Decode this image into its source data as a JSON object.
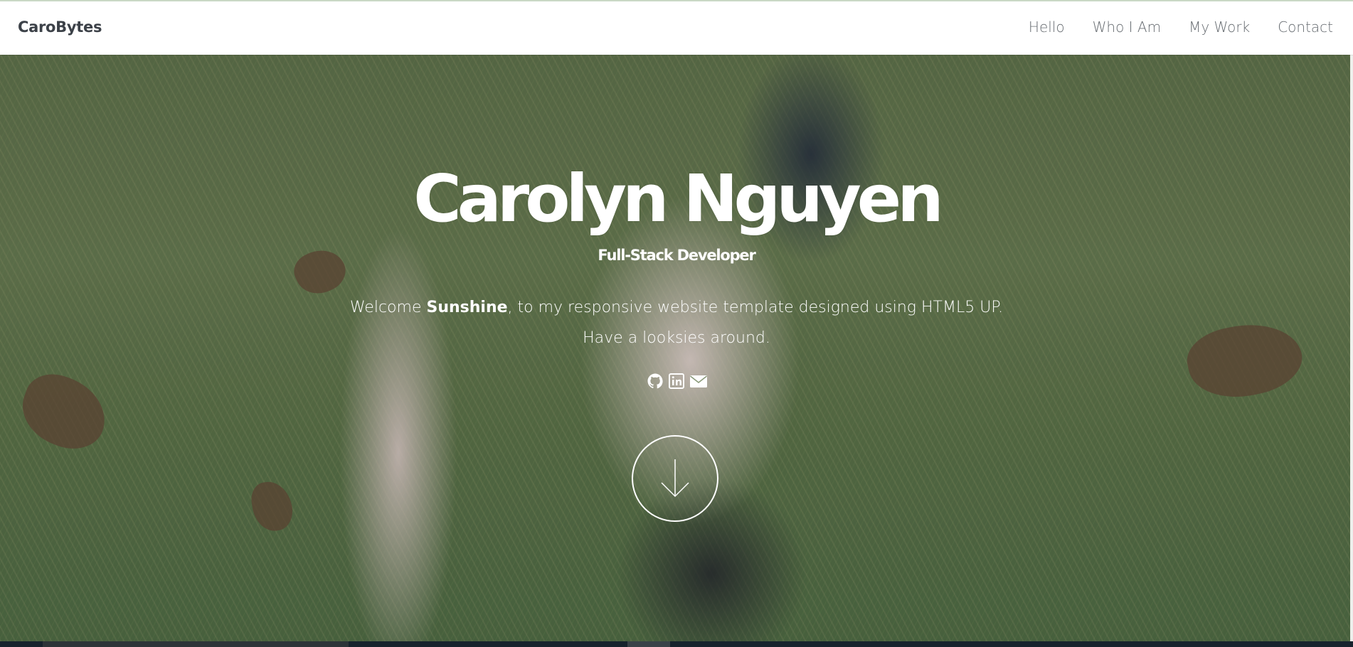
{
  "nav": {
    "brand": "CaroBytes",
    "links": [
      "Hello",
      "Who I Am",
      "My Work",
      "Contact"
    ]
  },
  "hero": {
    "title": "Carolyn Nguyen",
    "subtitle": "Full-Stack Developer",
    "welcome_prefix": "Welcome ",
    "welcome_name": "Sunshine",
    "welcome_suffix": ", to my responsive website template designed using HTML5 UP.",
    "line2": "Have a looksies around."
  },
  "social": [
    {
      "icon": "github-icon"
    },
    {
      "icon": "linkedin-icon"
    },
    {
      "icon": "envelope-icon"
    }
  ],
  "scroll": {
    "icon": "arrow-down-icon"
  },
  "colors": {
    "brand_text": "#3c4148",
    "nav_text": "#666b70",
    "hero_text": "#ffffff"
  }
}
